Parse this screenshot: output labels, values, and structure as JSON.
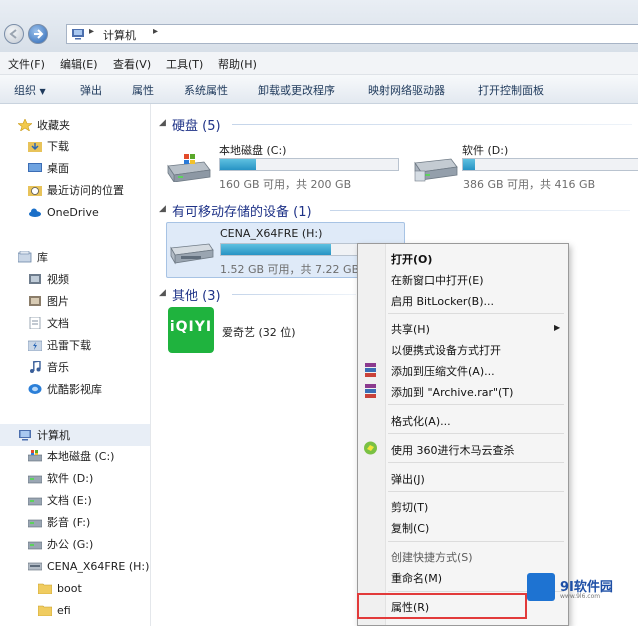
{
  "address": {
    "crumb": "计算机",
    "separator": "▸"
  },
  "menu": [
    "文件(F)",
    "编辑(E)",
    "查看(V)",
    "工具(T)",
    "帮助(H)"
  ],
  "commands": [
    "组织",
    "弹出",
    "属性",
    "系统属性",
    "卸载或更改程序",
    "映射网络驱动器",
    "打开控制面板"
  ],
  "organize_arrow": "▼",
  "nav": {
    "favorites_title": "收藏夹",
    "favorites": [
      "下载",
      "桌面",
      "最近访问的位置",
      "OneDrive"
    ],
    "library_title": "库",
    "library": [
      "视频",
      "图片",
      "文档",
      "迅雷下载",
      "音乐",
      "优酷影视库"
    ],
    "computer_title": "计算机",
    "computer": [
      "本地磁盘 (C:)",
      "软件 (D:)",
      "文档 (E:)",
      "影音 (F:)",
      "办公 (G:)",
      "CENA_X64FRE (H:)"
    ],
    "folders": [
      "boot",
      "efi"
    ]
  },
  "groups": {
    "hdd": "硬盘 (5)",
    "removable": "有可移动存储的设备 (1)",
    "other": "其他 (3)",
    "arrow": "◢"
  },
  "drives": [
    {
      "name": "本地磁盘 (C:)",
      "space": "160 GB 可用，共 200 GB",
      "fill": 0.2
    },
    {
      "name": "软件 (D:)",
      "space": "386 GB 可用，共 416 GB",
      "fill": 0.07
    },
    {
      "name": "CENA_X64FRE (H:)",
      "space": "1.52 GB 可用，共 7.22 GB",
      "fill": 0.79
    }
  ],
  "other_item": {
    "name": "爱奇艺 (32 位)",
    "logo_text": "iQIYI"
  },
  "context_menu": {
    "items": [
      "打开(O)",
      "在新窗口中打开(E)",
      "启用 BitLocker(B)...",
      "共享(H)",
      "以便携式设备方式打开",
      "添加到压缩文件(A)...",
      "添加到 \"Archive.rar\"(T)",
      "格式化(A)...",
      "使用 360进行木马云查杀",
      "弹出(J)",
      "剪切(T)",
      "复制(C)",
      "创建快捷方式(S)",
      "重命名(M)",
      "属性(R)"
    ],
    "submenu_arrow": "▶"
  },
  "watermark": {
    "text": "9I软件园",
    "url": "www.9l6.com"
  },
  "colors": {
    "accent_blue": "#2a66b5",
    "bar_fill": "#2793c4",
    "highlight_red": "#e23a3a",
    "iqiyi_green": "#1fb33e"
  }
}
